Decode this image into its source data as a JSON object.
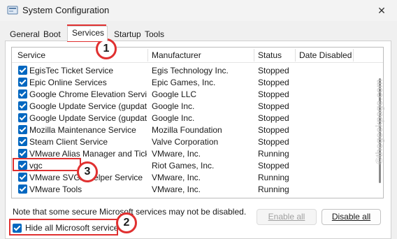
{
  "window": {
    "title": "System Configuration",
    "close_glyph": "✕"
  },
  "tabs": [
    "General",
    "Boot",
    "Services",
    "Startup",
    "Tools"
  ],
  "columns": [
    "Service",
    "Manufacturer",
    "Status",
    "Date Disabled"
  ],
  "services": [
    {
      "name": "EgisTec Ticket Service",
      "manufacturer": "Egis Technology Inc.",
      "status": "Stopped"
    },
    {
      "name": "Epic Online Services",
      "manufacturer": "Epic Games, Inc.",
      "status": "Stopped"
    },
    {
      "name": "Google Chrome Elevation Servic...",
      "manufacturer": "Google LLC",
      "status": "Stopped"
    },
    {
      "name": "Google Update Service (gupdate)",
      "manufacturer": "Google Inc.",
      "status": "Stopped"
    },
    {
      "name": "Google Update Service (gupdatem)",
      "manufacturer": "Google Inc.",
      "status": "Stopped"
    },
    {
      "name": "Mozilla Maintenance Service",
      "manufacturer": "Mozilla Foundation",
      "status": "Stopped"
    },
    {
      "name": "Steam Client Service",
      "manufacturer": "Valve Corporation",
      "status": "Stopped"
    },
    {
      "name": "VMware Alias Manager and Ticke...",
      "manufacturer": "VMware, Inc.",
      "status": "Running"
    },
    {
      "name": "vgc",
      "manufacturer": "Riot Games, Inc.",
      "status": "Stopped"
    },
    {
      "name": "VMware SVGA Helper Service",
      "manufacturer": "VMware, Inc.",
      "status": "Running"
    },
    {
      "name": "VMware Tools",
      "manufacturer": "VMware, Inc.",
      "status": "Running"
    }
  ],
  "note": "Note that some secure Microsoft services may not be disabled.",
  "buttons": {
    "enable_all": "Enable all",
    "disable_all": "Disable all"
  },
  "hide_ms": {
    "label": "Hide all Microsoft services",
    "checked": true
  },
  "annotations": [
    "1",
    "2",
    "3"
  ],
  "watermark": "©thegeekpage.com",
  "colors": {
    "checkbox": "#0067c0",
    "highlight": "#e03030"
  }
}
